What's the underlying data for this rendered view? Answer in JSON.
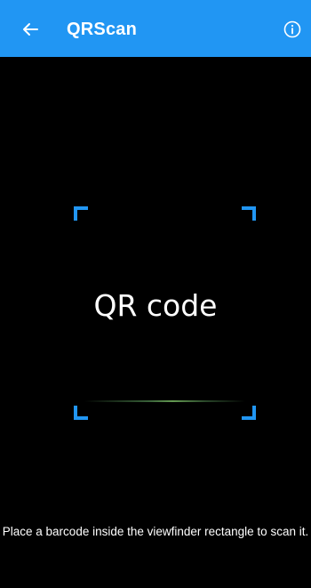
{
  "appbar": {
    "title": "QRScan",
    "back_icon": "arrow-left-icon",
    "info_icon": "info-circle-icon",
    "color": "#2196F3"
  },
  "scanner": {
    "placeholder_label": "QR code",
    "hint": "Place a barcode inside the viewfinder rectangle to scan it.",
    "corner_color": "#2196F3",
    "laser_color": "#6aa85a"
  }
}
